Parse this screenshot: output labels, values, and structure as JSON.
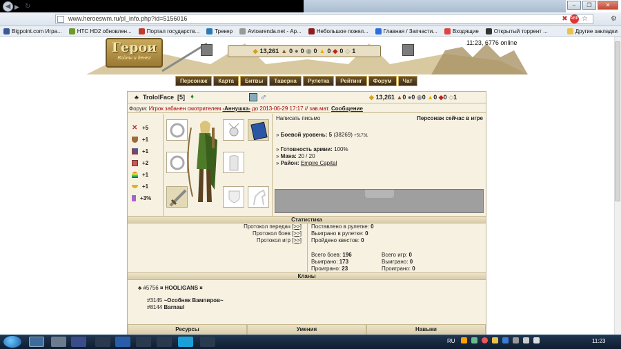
{
  "browser": {
    "url": "www.heroeswm.ru/pl_info.php?id=5156016",
    "bookmarks": [
      {
        "label": "Bigpoint.com Игра...",
        "color": "#3b5998"
      },
      {
        "label": "HTC HD2 обновлен...",
        "color": "#6b9b2c"
      },
      {
        "label": "Портал государств...",
        "color": "#c0392b"
      },
      {
        "label": "Трекер",
        "color": "#2c7ab6"
      },
      {
        "label": "Avtoarenda.net - Ар...",
        "color": "#999999"
      },
      {
        "label": "Небольшое пожел...",
        "color": "#8e1b1b"
      },
      {
        "label": "Главная / Запчасти...",
        "color": "#2a6fdb"
      },
      {
        "label": "Входящие",
        "color": "#d44"
      },
      {
        "label": "Открытый торрент ...",
        "color": "#333333"
      },
      {
        "label": "Другие закладки",
        "color": "#e8c34d"
      }
    ],
    "window_controls": [
      "–",
      "❐",
      "✕"
    ]
  },
  "header": {
    "logo_title": "Герои",
    "logo_subtitle": "Войны и денег",
    "resources": [
      {
        "icon": "gold-icon",
        "value": "13,261"
      },
      {
        "icon": "wood-icon",
        "value": "0"
      },
      {
        "icon": "ore-icon",
        "value": "0"
      },
      {
        "icon": "mercury-icon",
        "value": "0"
      },
      {
        "icon": "sulfur-icon",
        "value": "0"
      },
      {
        "icon": "crystal-icon",
        "value": "0"
      },
      {
        "icon": "gems-icon",
        "value": "1"
      }
    ],
    "online_status": "11:23, 6776 online",
    "menu": [
      "Персонаж",
      "Карта",
      "Битвы",
      "Таверна",
      "Рулетка",
      "Рейтинг",
      "Форум",
      "Чат"
    ]
  },
  "player": {
    "name": "TrololFace",
    "level": "[5]",
    "gold": "13,261",
    "resources": [
      "0",
      "0",
      "0",
      "0",
      "0",
      "1"
    ],
    "forum_ban": {
      "prefix": "Форум: ",
      "text": "Игрок забанен смотрителем ",
      "moderator": "-Аннушка-",
      "until": " до 2013-06-29 17:17 // зав.мат. ",
      "link": "Сообщение"
    },
    "stats": [
      {
        "icon": "attack-icon",
        "value": "+5"
      },
      {
        "icon": "defense-icon",
        "value": "+1"
      },
      {
        "icon": "spellpower-icon",
        "value": "+1"
      },
      {
        "icon": "knowledge-icon",
        "value": "+2"
      },
      {
        "icon": "luck-icon",
        "value": "+1"
      },
      {
        "icon": "morale-icon",
        "value": "+1"
      },
      {
        "icon": "initiative-icon",
        "value": "+3%"
      }
    ],
    "write_letter": "Написать письмо",
    "status": "Персонаж сейчас в игре",
    "combat_level_label": "Боевой уровень:",
    "combat_level": "5",
    "combat_points": "(38269)",
    "combat_delta": "+51731",
    "army_label": "Готовность армии:",
    "army": "100%",
    "mana_label": "Мана:",
    "mana": "20 / 20",
    "district_label": "Район:",
    "district": "Empire Capital"
  },
  "statistics": {
    "title": "Статистика",
    "protocols": [
      {
        "label": "Протокол передач",
        "link": "[>>]"
      },
      {
        "label": "Протокол боев",
        "link": "[>>]"
      },
      {
        "label": "Протокол игр",
        "link": "[>>]"
      }
    ],
    "roulette": [
      {
        "label": "Поставлено в рулетке:",
        "value": "0"
      },
      {
        "label": "Выиграно в рулетке:",
        "value": "0"
      },
      {
        "label": "Пройдено квестов:",
        "value": "0"
      }
    ],
    "battles": [
      {
        "label": "Всего боев:",
        "value": "196"
      },
      {
        "label": "Выиграно:",
        "value": "173"
      },
      {
        "label": "Проиграно:",
        "value": "23"
      }
    ],
    "games": [
      {
        "label": "Всего игр:",
        "value": "0"
      },
      {
        "label": "Выиграно:",
        "value": "0"
      },
      {
        "label": "Проиграно:",
        "value": "0"
      }
    ]
  },
  "clans": {
    "title": "Кланы",
    "items": [
      {
        "id": "#5756",
        "name": "¤ HOOLIGANS ¤"
      },
      {
        "id": "#3145",
        "name": "~Особняк Вампиров~"
      },
      {
        "id": "#8144",
        "name": "Barnaul"
      }
    ]
  },
  "bottom_tabs": [
    "Ресурсы",
    "Умения",
    "Навыки"
  ],
  "taskbar": {
    "lang": "RU",
    "time": "11:23"
  }
}
